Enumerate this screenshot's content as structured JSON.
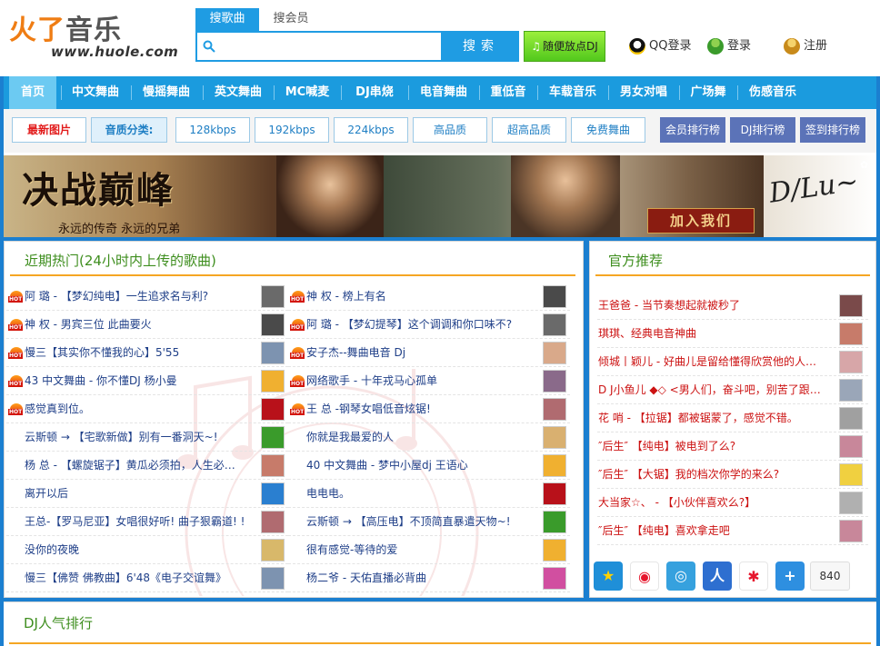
{
  "site": {
    "logo_cn_a": "火了",
    "logo_cn_b": "音乐",
    "logo_url": "www.huole.com"
  },
  "search": {
    "tab_songs": "搜歌曲",
    "tab_members": "搜会员",
    "placeholder": "",
    "value": "",
    "button": "搜索",
    "random_play": "随便放点DJ"
  },
  "header_links": {
    "qq_login": "QQ登录",
    "login": "登录",
    "register": "注册"
  },
  "nav": {
    "items": [
      "首页",
      "中文舞曲",
      "慢摇舞曲",
      "英文舞曲",
      "MC喊麦",
      "DJ串烧",
      "电音舞曲",
      "重低音",
      "车载音乐",
      "男女对唱",
      "广场舞",
      "伤感音乐"
    ]
  },
  "subbar": {
    "latest": "最新图片",
    "quality_label": "音质分类:",
    "qualities": [
      "128kbps",
      "192kbps",
      "224kbps",
      "高品质",
      "超高品质",
      "免费舞曲"
    ],
    "ranks": [
      "会员排行榜",
      "DJ排行榜",
      "签到排行榜"
    ]
  },
  "banner": {
    "title": "决战巅峰",
    "subtitle": "永远的传奇 永远的兄弟",
    "join": "加入我们",
    "signature": "D/Lu~"
  },
  "hot": {
    "title": "近期热门(24小时内上传的歌曲)",
    "left": [
      {
        "text": "阿 璐 - 【梦幻纯电】一生追求名与利?",
        "hot": true,
        "thumb": "#6a6a6a"
      },
      {
        "text": "神 权 - 男宾三位 此曲要火",
        "hot": true,
        "thumb": "#4a4a4a"
      },
      {
        "text": "慢三【其实你不懂我的心】5'55",
        "hot": true,
        "thumb": "#7d93b0"
      },
      {
        "text": "43 中文舞曲 - 你不懂DJ 杨小曼",
        "hot": true,
        "thumb": "#f0b030"
      },
      {
        "text": "感觉真到位。",
        "hot": true,
        "thumb": "#b8111a"
      },
      {
        "text": "云斯顿 → 【宅歌新做】别有一番洞天~!",
        "hot": false,
        "thumb": "#3a9b2b"
      },
      {
        "text": "杨 总 - 【螺旋锯子】黄瓜必须拍，人生必…",
        "hot": false,
        "thumb": "#c77b6a"
      },
      {
        "text": "离开以后",
        "hot": false,
        "thumb": "#2a7fd0"
      },
      {
        "text": "王总-【罗马尼亚】女唱很好听! 曲子狠霸道! !",
        "hot": false,
        "thumb": "#b06b70"
      },
      {
        "text": "没你的夜晚",
        "hot": false,
        "thumb": "#d8b86a"
      },
      {
        "text": "慢三【佛赞 佛教曲】6'48《电子交谊舞》",
        "hot": false,
        "thumb": "#7d93b0"
      }
    ],
    "right": [
      {
        "text": "神 权 - 榜上有名",
        "hot": true,
        "thumb": "#4a4a4a"
      },
      {
        "text": "阿 璐 - 【梦幻提琴】这个调调和你口味不?",
        "hot": true,
        "thumb": "#6a6a6a"
      },
      {
        "text": "安子杰--舞曲电音 Dj",
        "hot": true,
        "thumb": "#d9a98a"
      },
      {
        "text": "网络歌手 - 十年戎马心孤单",
        "hot": true,
        "thumb": "#8a6a8a"
      },
      {
        "text": "王 总 -钢琴女唱低音炫锯!",
        "hot": true,
        "thumb": "#b06b70"
      },
      {
        "text": "你就是我最爱的人",
        "hot": false,
        "thumb": "#d9b070"
      },
      {
        "text": "40 中文舞曲 - 梦中小屋dj 王语心",
        "hot": false,
        "thumb": "#f0b030"
      },
      {
        "text": "电电电。",
        "hot": false,
        "thumb": "#b8111a"
      },
      {
        "text": "云斯顿 → 【高压电】不顶简直暴遣天物~!",
        "hot": false,
        "thumb": "#3a9b2b"
      },
      {
        "text": "很有感觉-等待的爱",
        "hot": false,
        "thumb": "#f0b030"
      },
      {
        "text": "杨二爷 - 天佑直播必背曲",
        "hot": false,
        "thumb": "#d14fa0"
      }
    ]
  },
  "official": {
    "title": "官方推荐",
    "items": [
      {
        "text": "王爸爸 - 当节奏想起就被秒了",
        "thumb": "#7a4a4a"
      },
      {
        "text": "琪琪、经典电音神曲",
        "thumb": "#c77b6a"
      },
      {
        "text": "倾城丨颖儿 - 好曲儿是留给懂得欣赏他的人…",
        "thumb": "#d7a6a8"
      },
      {
        "text": "D J小鱼儿 ◆◇ <男人们，奋斗吧，别苦了跟…",
        "thumb": "#9aa6b8"
      },
      {
        "text": "花 哨 - 【拉锯】都被锯蒙了，感觉不错。",
        "thumb": "#a0a0a0"
      },
      {
        "text": "″后生″ 【纯电】被电到了么?",
        "thumb": "#c8879a"
      },
      {
        "text": "″后生″ 【大锯】我的档次你学的来么?",
        "thumb": "#f0d040"
      },
      {
        "text": "大当家☆、 - 【小伙伴喜欢么?】",
        "thumb": "#b0b0b0"
      },
      {
        "text": "″后生″ 【纯电】喜欢拿走吧",
        "thumb": "#c8879a"
      }
    ],
    "share_count": "840"
  },
  "dj_rank": {
    "title": "DJ人气排行"
  }
}
